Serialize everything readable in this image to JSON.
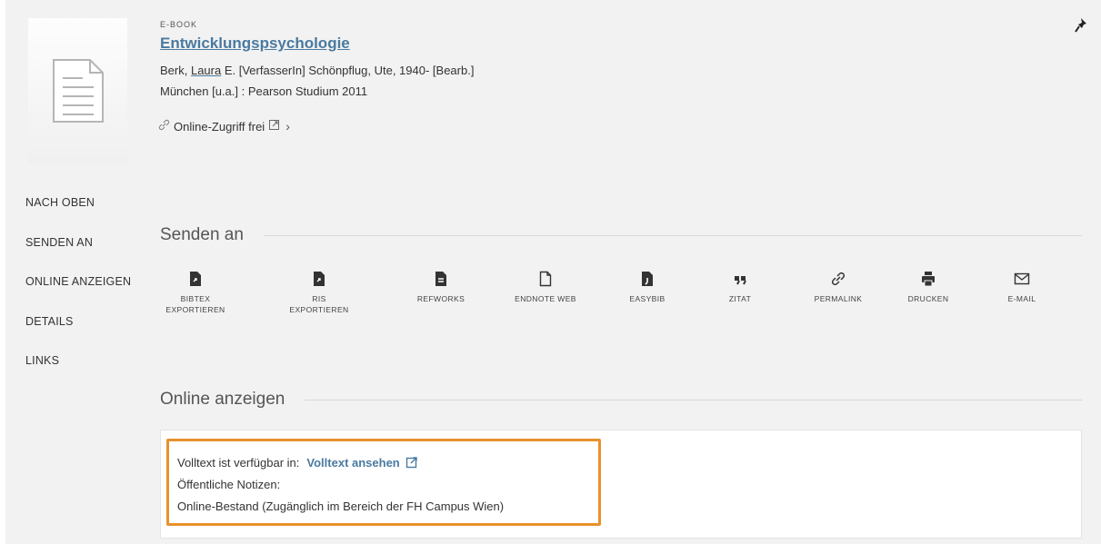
{
  "record": {
    "type": "E-BOOK",
    "title": "Entwicklungspsychologie",
    "author_prefix": "Berk, ",
    "author_link": "Laura",
    "author_suffix": " E. [VerfasserIn] Schönpflug, Ute, 1940- [Bearb.]",
    "publisher": "München [u.a.] : Pearson Studium 2011",
    "online_access": "Online-Zugriff frei",
    "thumbnail_icon": "document-icon",
    "pin_icon": "pin-icon"
  },
  "side_nav": {
    "items": [
      "NACH OBEN",
      "SENDEN AN",
      "ONLINE ANZEIGEN",
      "DETAILS",
      "LINKS"
    ]
  },
  "send_to": {
    "heading": "Senden an",
    "actions": [
      {
        "label": "BIBTEX EXPORTIEREN",
        "icon": "file-export-icon"
      },
      {
        "label": "RIS EXPORTIEREN",
        "icon": "file-export-icon"
      },
      {
        "label": "REFWORKS",
        "icon": "file-text-icon"
      },
      {
        "label": "ENDNOTE WEB",
        "icon": "file-outline-icon"
      },
      {
        "label": "EASYBIB",
        "icon": "file-easybib-icon"
      },
      {
        "label": "ZITAT",
        "icon": "quote-icon"
      },
      {
        "label": "PERMALINK",
        "icon": "link-icon"
      },
      {
        "label": "DRUCKEN",
        "icon": "printer-icon"
      },
      {
        "label": "E-MAIL",
        "icon": "mail-icon"
      }
    ]
  },
  "online_view": {
    "heading": "Online anzeigen",
    "fulltext_label": "Volltext ist verfügbar in:",
    "fulltext_link": "Volltext ansehen",
    "notes_label": "Öffentliche Notizen:",
    "holding": "Online-Bestand (Zugänglich im Bereich der FH Campus Wien)"
  },
  "colors": {
    "link": "#4a7aa0",
    "highlight": "#e8912c",
    "panel_bg": "#f2f2f2"
  }
}
